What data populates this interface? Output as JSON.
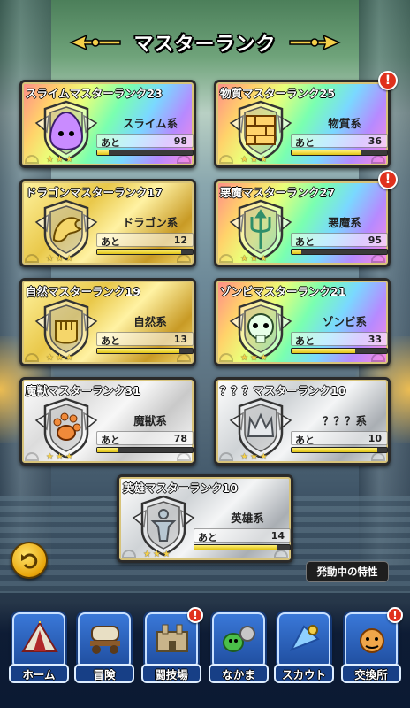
{
  "header": {
    "title": "マスターランク"
  },
  "cards": [
    {
      "title": "スライムマスターランク23",
      "type": "スライム系",
      "ato": "あと",
      "remaining": "98",
      "progress": 0.12,
      "style": "rainbow",
      "alert": false,
      "emblem": "slime-emblem-icon"
    },
    {
      "title": "物質マスターランク25",
      "type": "物質系",
      "ato": "あと",
      "remaining": "36",
      "progress": 0.72,
      "style": "rainbow",
      "alert": true,
      "emblem": "brick-emblem-icon"
    },
    {
      "title": "ドラゴンマスターランク17",
      "type": "ドラゴン系",
      "ato": "あと",
      "remaining": "12",
      "progress": 0.88,
      "style": "gold",
      "alert": false,
      "emblem": "dragon-emblem-icon"
    },
    {
      "title": "悪魔マスターランク27",
      "type": "悪魔系",
      "ato": "あと",
      "remaining": "95",
      "progress": 0.1,
      "style": "rainbow",
      "alert": true,
      "emblem": "trident-emblem-icon"
    },
    {
      "title": "自然マスターランク19",
      "type": "自然系",
      "ato": "あと",
      "remaining": "13",
      "progress": 0.86,
      "style": "gold",
      "alert": false,
      "emblem": "fist-emblem-icon"
    },
    {
      "title": "ゾンビマスターランク21",
      "type": "ゾンビ系",
      "ato": "あと",
      "remaining": "33",
      "progress": 0.67,
      "style": "rainbow",
      "alert": false,
      "emblem": "skull-emblem-icon"
    },
    {
      "title": "魔獣マスターランク31",
      "type": "魔獣系",
      "ato": "あと",
      "remaining": "78",
      "progress": 0.22,
      "style": "silver-rainbow",
      "alert": false,
      "emblem": "paw-emblem-icon"
    },
    {
      "title": "？？？マスターランク10",
      "type": "？？？系",
      "ato": "あと",
      "remaining": "10",
      "progress": 0.9,
      "style": "silver",
      "alert": false,
      "emblem": "crown-emblem-icon"
    },
    {
      "title": "英雄マスターランク10",
      "type": "英雄系",
      "ato": "あと",
      "remaining": "14",
      "progress": 0.86,
      "style": "silver",
      "alert": false,
      "emblem": "hero-emblem-icon"
    }
  ],
  "buttons": {
    "trait": "発動中の特性"
  },
  "nav": [
    {
      "label": "ホーム",
      "alert": false
    },
    {
      "label": "冒険",
      "alert": false
    },
    {
      "label": "闘技場",
      "alert": true
    },
    {
      "label": "なかま",
      "alert": false
    },
    {
      "label": "スカウト",
      "alert": false
    },
    {
      "label": "交換所",
      "alert": true
    }
  ],
  "alert_mark": "!",
  "colors": {
    "gold": "#e9c84a",
    "silver": "#cfd3d6",
    "alert_red": "#e0311d",
    "nav_blue": "#173f86",
    "progress_yellow": "#fff27a"
  }
}
